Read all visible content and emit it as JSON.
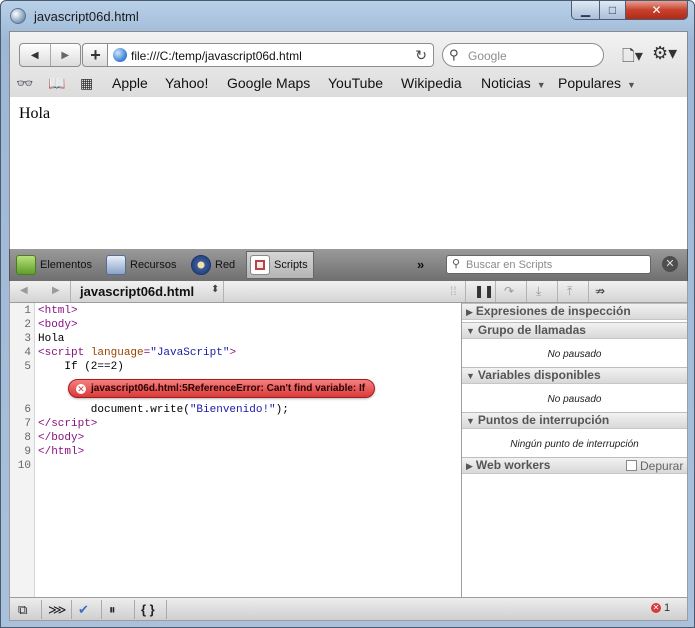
{
  "window": {
    "title": "javascript06d.html",
    "controls": {
      "minimize": "▁",
      "maximize": "□",
      "close": "✕"
    }
  },
  "toolbar": {
    "url": "file:///C:/temp/javascript06d.html",
    "search_placeholder": "Google"
  },
  "bookmarks": {
    "items": [
      {
        "label": "Apple",
        "dropdown": false
      },
      {
        "label": "Yahoo!",
        "dropdown": false
      },
      {
        "label": "Google Maps",
        "dropdown": false
      },
      {
        "label": "YouTube",
        "dropdown": false
      },
      {
        "label": "Wikipedia",
        "dropdown": false
      },
      {
        "label": "Noticias",
        "dropdown": true
      },
      {
        "label": "Populares",
        "dropdown": true
      }
    ],
    "caret": "▼"
  },
  "page": {
    "body_text": "Hola"
  },
  "inspector": {
    "tabs": [
      {
        "label": "Elementos",
        "icon": "elements-icon",
        "color": "#7fbf3f"
      },
      {
        "label": "Recursos",
        "icon": "resources-icon",
        "color": "#6f8fbf"
      },
      {
        "label": "Red",
        "icon": "network-icon",
        "color": "#3f5fa0"
      },
      {
        "label": "Scripts",
        "icon": "scripts-icon",
        "color": "#c04040"
      }
    ],
    "more": "»",
    "search_placeholder": "Buscar en Scripts",
    "close": "✕"
  },
  "scripts": {
    "file_name": "javascript06d.html",
    "nav_back": "◀",
    "nav_forward": "▶",
    "updown": "⬍",
    "source_lines": [
      {
        "num": "1",
        "html": "<span class=\"tag\">&lt;html&gt;</span>"
      },
      {
        "num": "2",
        "html": "<span class=\"tag\">&lt;body&gt;</span>"
      },
      {
        "num": "3",
        "html": "<span class=\"plain\">Hola</span>"
      },
      {
        "num": "4",
        "html": "<span class=\"tag\">&lt;script </span><span class=\"attr\">language</span><span class=\"tag\">=</span><span class=\"str\">\"JavaScript\"</span><span class=\"tag\">&gt;</span>"
      },
      {
        "num": "5",
        "html": "<span class=\"plain\">    If (2==2)</span>"
      },
      {
        "num": "6",
        "html": "<span class=\"plain\">        document.write(</span><span class=\"str\">\"Bienvenido!\"</span><span class=\"plain\">);</span>"
      },
      {
        "num": "7",
        "html": "<span class=\"tag\">&lt;/script&gt;</span>"
      },
      {
        "num": "8",
        "html": "<span class=\"tag\">&lt;/body&gt;</span>"
      },
      {
        "num": "9",
        "html": "<span class=\"tag\">&lt;/html&gt;</span>"
      },
      {
        "num": "10",
        "html": ""
      }
    ],
    "error_message": "javascript06d.html:5ReferenceError: Can't find variable: If"
  },
  "sidebar": {
    "sections": [
      {
        "title": "Expresiones de inspección",
        "body": "",
        "expanded": false
      },
      {
        "title": "Grupo de llamadas",
        "body": "No pausado",
        "expanded": true
      },
      {
        "title": "Variables disponibles",
        "body": "No pausado",
        "expanded": true
      },
      {
        "title": "Puntos de interrupción",
        "body": "Ningún punto de interrupción",
        "expanded": true
      },
      {
        "title": "Web workers",
        "body": "",
        "expanded": false
      }
    ],
    "workers_checkbox_label": "Depurar"
  },
  "status": {
    "error_count": "1"
  }
}
